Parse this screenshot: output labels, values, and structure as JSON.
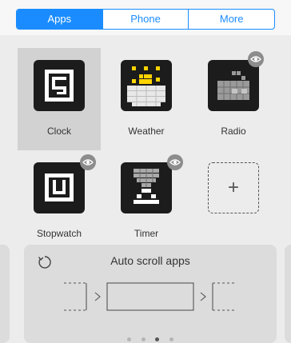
{
  "tabs": [
    {
      "label": "Apps",
      "active": true
    },
    {
      "label": "Phone",
      "active": false
    },
    {
      "label": "More",
      "active": false
    }
  ],
  "apps": [
    {
      "label": "Clock",
      "icon": "clock-icon",
      "selected": true,
      "hidden_badge": false
    },
    {
      "label": "Weather",
      "icon": "weather-icon",
      "selected": false,
      "hidden_badge": false
    },
    {
      "label": "Radio",
      "icon": "radio-icon",
      "selected": false,
      "hidden_badge": true
    },
    {
      "label": "Stopwatch",
      "icon": "stopwatch-icon",
      "selected": false,
      "hidden_badge": true
    },
    {
      "label": "Timer",
      "icon": "timer-icon",
      "selected": false,
      "hidden_badge": true
    }
  ],
  "add_tile": {
    "icon": "plus-icon",
    "symbol": "+"
  },
  "auto_scroll": {
    "title": "Auto scroll apps",
    "icon": "refresh-icon",
    "page_indicator": {
      "count": 4,
      "active_index": 2
    }
  },
  "colors": {
    "accent": "#1a8cff",
    "tile_bg": "#1c1c1c",
    "weather_sun": "#ffd400"
  }
}
